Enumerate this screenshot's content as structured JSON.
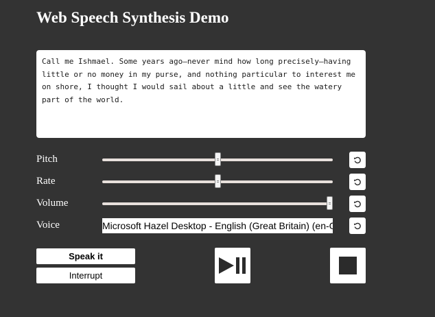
{
  "title": "Web Speech Synthesis Demo",
  "text_input": {
    "value": "Call me Ishmael. Some years ago—never mind how long precisely—having little or no money in my purse, and nothing particular to interest me on shore, I thought I would sail about a little and see the watery part of the world."
  },
  "controls": {
    "pitch": {
      "label": "Pitch",
      "value_fraction": 0.5
    },
    "rate": {
      "label": "Rate",
      "value_fraction": 0.5
    },
    "volume": {
      "label": "Volume",
      "value_fraction": 1.0
    },
    "voice": {
      "label": "Voice",
      "selected": "Microsoft Hazel Desktop - English (Great Britain) (en-GB)"
    }
  },
  "buttons": {
    "speak": "Speak it",
    "interrupt": "Interrupt"
  },
  "icons": {
    "reset": "reset-icon",
    "play_pause": "play-pause-icon",
    "stop": "stop-icon"
  },
  "colors": {
    "background": "#333333",
    "slider_track": "#e8e0dc",
    "icon_dark": "#2b2b2b"
  }
}
